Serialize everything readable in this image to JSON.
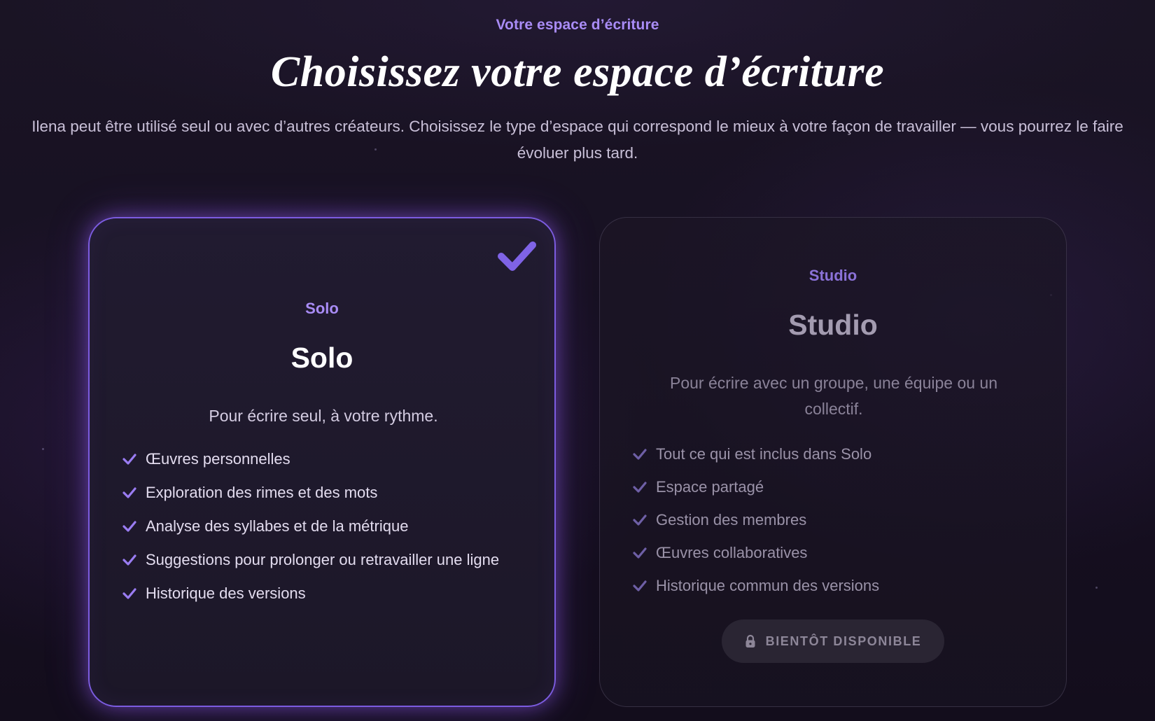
{
  "header": {
    "eyebrow": "Votre espace d’écriture",
    "title": "Choisissez votre espace d’écriture",
    "subtitle": "Ilena peut être utilisé seul ou avec d’autres créateurs. Choisissez le type d’espace qui correspond le mieux à votre façon de travailler — vous pourrez le faire évoluer plus tard."
  },
  "colors": {
    "accent": "#a98cf6",
    "selected_border": "#7c5ce0",
    "background": "#15101f"
  },
  "plans": [
    {
      "tag": "Solo",
      "name": "Solo",
      "description": "Pour écrire seul, à votre rythme.",
      "selected": true,
      "selected_icon": "checkmark-icon",
      "features": [
        "Œuvres personnelles",
        "Exploration des rimes et des mots",
        "Analyse des syllabes et de la métrique",
        "Suggestions pour prolonger ou retravailler une ligne",
        "Historique des versions"
      ]
    },
    {
      "tag": "Studio",
      "name": "Studio",
      "description": "Pour écrire avec un groupe, une équipe ou un collectif.",
      "selected": false,
      "features": [
        "Tout ce qui est inclus dans Solo",
        "Espace partagé",
        "Gestion des membres",
        "Œuvres collaboratives",
        "Historique commun des versions"
      ],
      "button": {
        "label": "BIENTÔT DISPONIBLE",
        "icon": "lock-icon",
        "disabled": true
      }
    }
  ]
}
